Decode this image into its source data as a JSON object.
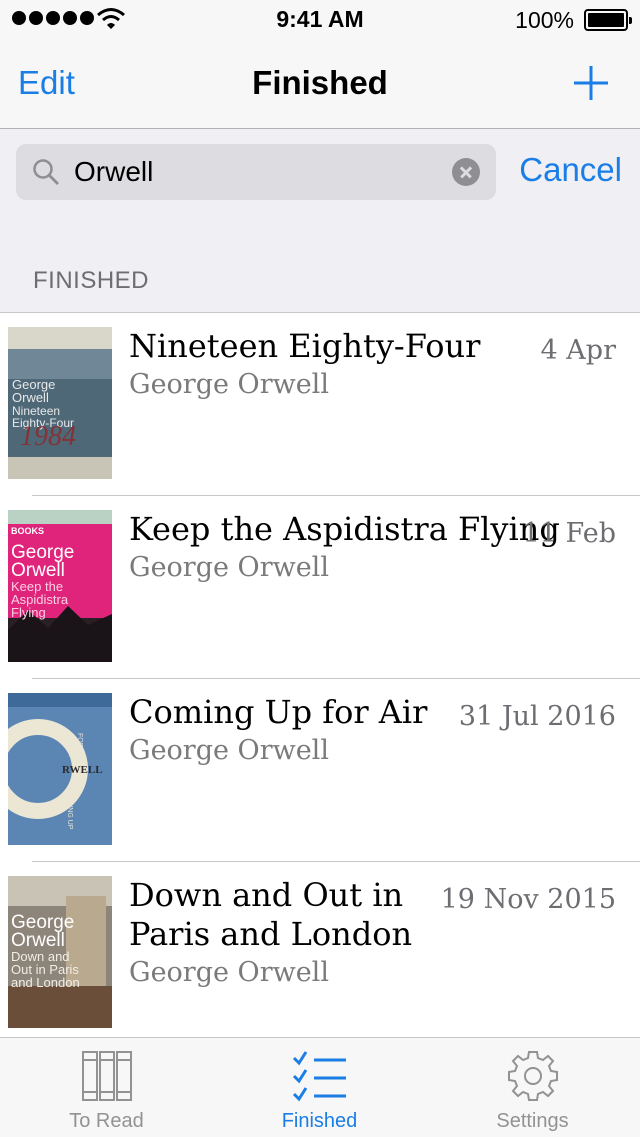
{
  "status_bar": {
    "time": "9:41 AM",
    "battery_percent": "100%"
  },
  "nav": {
    "edit_label": "Edit",
    "title": "Finished"
  },
  "search": {
    "value": "Orwell",
    "cancel_label": "Cancel"
  },
  "section_header": "FINISHED",
  "books": [
    {
      "title": "Nineteen Eighty-Four",
      "author": "George Orwell",
      "date": "4 Apr"
    },
    {
      "title": "Keep the Aspidistra Flying",
      "author": "George Orwell",
      "date": "11 Feb"
    },
    {
      "title": "Coming Up for Air",
      "author": "George Orwell",
      "date": "31 Jul 2016"
    },
    {
      "title": "Down and Out in Paris and London",
      "author": "George Orwell",
      "date": "19 Nov 2015"
    }
  ],
  "covers": {
    "c1": {
      "line1": "George",
      "line2": "Orwell",
      "line3": "Nineteen",
      "line4": "Eighty-Four",
      "scrawl": "1984"
    },
    "c2": {
      "banner": "BOOKS",
      "line1": "George",
      "line2": "Orwell",
      "line3": "Keep the",
      "line4": "Aspidistra",
      "line5": "Flying"
    },
    "c3": {
      "spine1": "RWELL",
      "spine2": "COMING UP",
      "spine3": "FOR AIR"
    },
    "c4": {
      "line1": "George",
      "line2": "Orwell",
      "line3": "Down and",
      "line4": "Out in Paris",
      "line5": "and London"
    }
  },
  "tabs": [
    {
      "label": "To Read",
      "icon": "books-icon",
      "active": false
    },
    {
      "label": "Finished",
      "icon": "checklist-icon",
      "active": true
    },
    {
      "label": "Settings",
      "icon": "gear-icon",
      "active": false
    }
  ],
  "colors": {
    "accent": "#1a7ee6",
    "tab_inactive": "#929292"
  }
}
